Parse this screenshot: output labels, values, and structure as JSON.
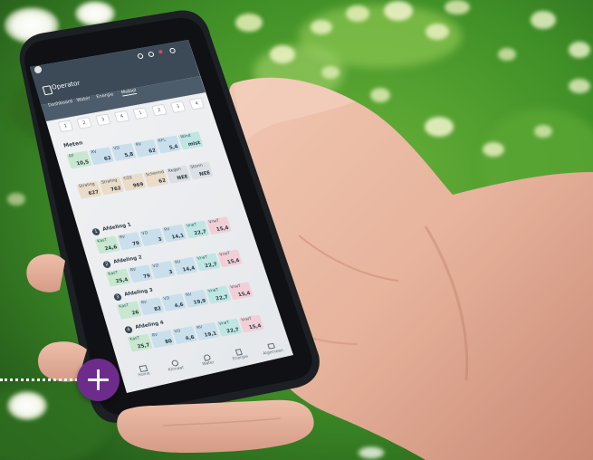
{
  "app": {
    "title": "Operator"
  },
  "nav": {
    "tabs": [
      "Dashboard",
      "Water",
      "Energie",
      "Mobiel"
    ],
    "active_tab": "Mobiel"
  },
  "pager": [
    "1",
    "2",
    "3",
    "4",
    "1",
    "2",
    "3",
    "4"
  ],
  "meten": {
    "heading": "Meten",
    "row1": [
      {
        "k": "RF",
        "v": "10,5"
      },
      {
        "k": "RV",
        "v": "62"
      },
      {
        "k": "VD",
        "v": "5,8"
      },
      {
        "k": "RV",
        "v": "62"
      },
      {
        "k": "RFL",
        "v": "5,4"
      },
      {
        "k": "Wind",
        "v": "mist"
      }
    ],
    "row2": [
      {
        "k": "Straling",
        "v": "627"
      },
      {
        "k": "Straling",
        "v": "762"
      },
      {
        "k": "CO2",
        "v": "969"
      },
      {
        "k": "Schermd",
        "v": "62"
      },
      {
        "k": "Regen",
        "v": "NEE"
      },
      {
        "k": "Storm",
        "v": "NEE"
      }
    ]
  },
  "afdelingen": [
    {
      "num": "1",
      "name": "Afdeling 1",
      "tiles": [
        {
          "k": "KasT",
          "v": "24,6"
        },
        {
          "k": "RV",
          "v": "79"
        },
        {
          "k": "VD",
          "v": "3"
        },
        {
          "k": "RV",
          "v": "14,1"
        },
        {
          "k": "VrwT",
          "v": "22,7"
        },
        {
          "k": "VrwT",
          "v": "15,4"
        }
      ]
    },
    {
      "num": "2",
      "name": "Afdeling 2",
      "tiles": [
        {
          "k": "KasT",
          "v": "25,4"
        },
        {
          "k": "RV",
          "v": "79"
        },
        {
          "k": "VD",
          "v": "3"
        },
        {
          "k": "RV",
          "v": "14,4"
        },
        {
          "k": "VrwT",
          "v": "22,7"
        },
        {
          "k": "VrwT",
          "v": "15,4"
        }
      ]
    },
    {
      "num": "3",
      "name": "Afdeling 3",
      "tiles": [
        {
          "k": "KasT",
          "v": "26"
        },
        {
          "k": "RV",
          "v": "82"
        },
        {
          "k": "VD",
          "v": "4,6"
        },
        {
          "k": "RV",
          "v": "19,9"
        },
        {
          "k": "VrwT",
          "v": "22,7"
        },
        {
          "k": "VrwT",
          "v": "15,4"
        }
      ]
    },
    {
      "num": "4",
      "name": "Afdeling 4",
      "tiles": [
        {
          "k": "KasT",
          "v": "25,7"
        },
        {
          "k": "RV",
          "v": "80"
        },
        {
          "k": "VD",
          "v": "4,6"
        },
        {
          "k": "RV",
          "v": "19,1"
        },
        {
          "k": "VrwT",
          "v": "22,7"
        },
        {
          "k": "VrwT",
          "v": "15,4"
        }
      ]
    }
  ],
  "bottom_nav": [
    "Home",
    "Klimaat",
    "Water",
    "Energie",
    "Algemeen"
  ],
  "colors": {
    "accent": "#6d2c8c",
    "tile_green": "#c7e8cf",
    "tile_blue": "#c9dfec",
    "tile_teal": "#bfe6e3",
    "tile_pink": "#f2cfd7",
    "tile_tan": "#eadcc8",
    "tile_grey": "#dcdfe3",
    "screen_header": "#3c4a57"
  },
  "icons": [
    "app-logo-icon",
    "search-icon",
    "help-icon",
    "notification-icon",
    "settings-icon",
    "home-icon",
    "climate-icon",
    "water-icon",
    "energy-icon",
    "general-icon",
    "plus-icon"
  ]
}
